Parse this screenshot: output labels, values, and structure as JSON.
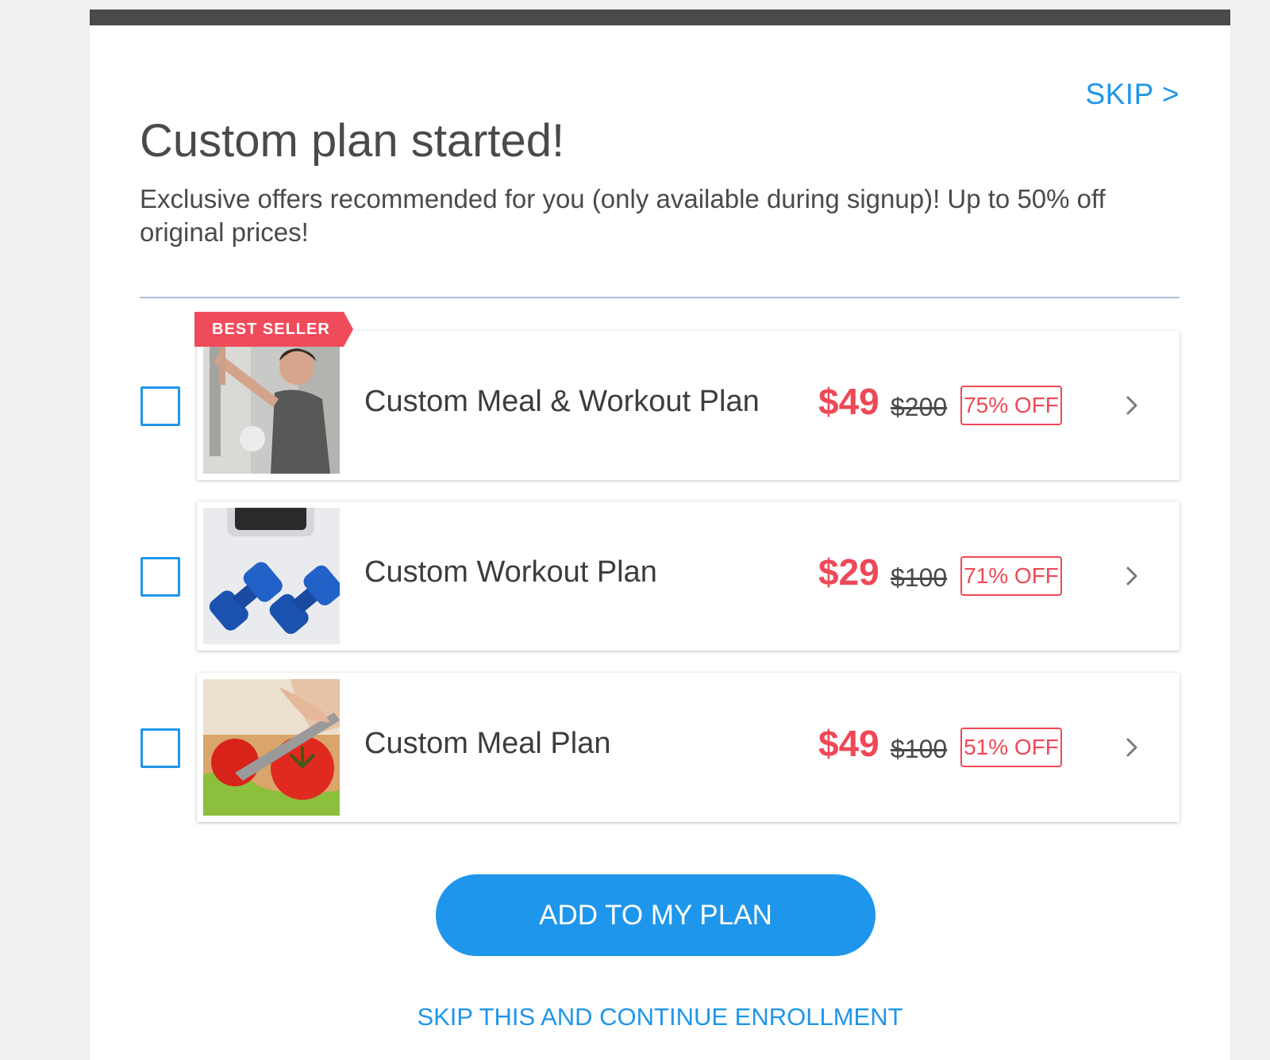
{
  "header": {
    "skip_label": "SKIP >",
    "title": "Custom plan started!",
    "subtitle": "Exclusive offers recommended for you (only available during signup)! Up to 50% off original prices!"
  },
  "offers": [
    {
      "ribbon": "BEST SELLER",
      "name": "Custom Meal & Workout Plan",
      "price": "$49",
      "original_price": "$200",
      "discount": "75% OFF",
      "image": "woman-high-five-photo",
      "checked": false
    },
    {
      "name": "Custom Workout Plan",
      "price": "$29",
      "original_price": "$100",
      "discount": "71% OFF",
      "image": "dumbbells-photo",
      "checked": false
    },
    {
      "name": "Custom Meal Plan",
      "price": "$49",
      "original_price": "$100",
      "discount": "51% OFF",
      "image": "tomato-cutting-photo",
      "checked": false
    }
  ],
  "actions": {
    "add_label": "ADD TO MY PLAN",
    "skip_label": "SKIP THIS AND CONTINUE ENROLLMENT"
  },
  "colors": {
    "accent_blue": "#1f96ea",
    "price_red": "#ef4856",
    "top_bar": "#4a4a4a"
  }
}
